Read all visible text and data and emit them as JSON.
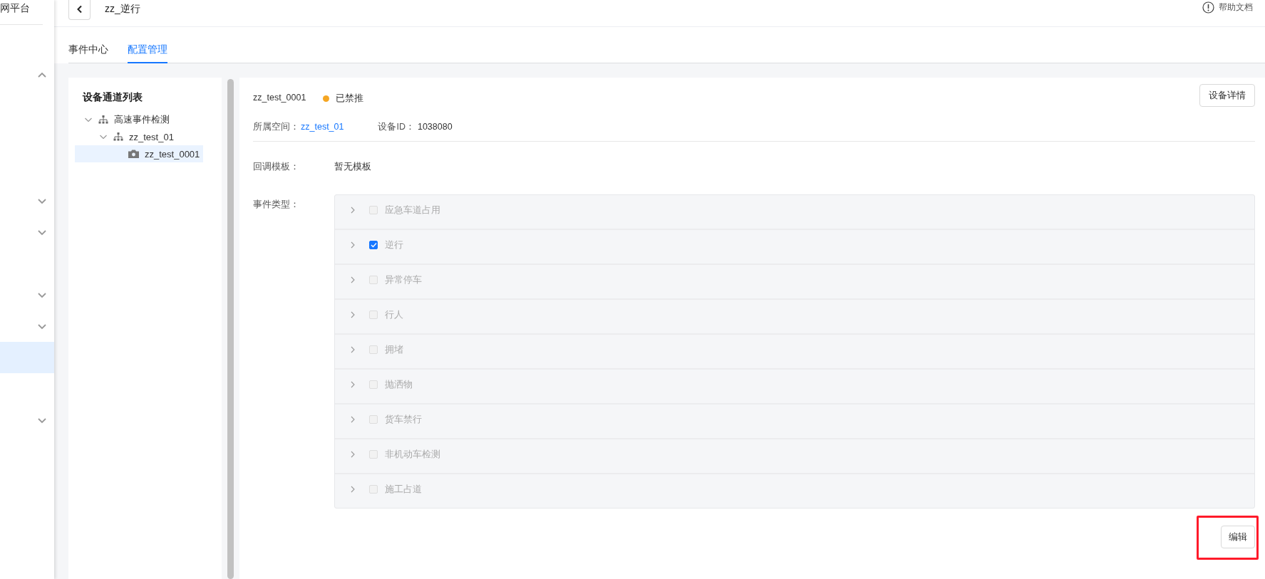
{
  "sidebar": {
    "title": "网平台",
    "items": [
      {
        "kind": "group",
        "expanded": true,
        "selected": false
      },
      {
        "kind": "entry",
        "selected": false
      },
      {
        "kind": "entry",
        "selected": false
      },
      {
        "kind": "entry",
        "selected": false
      },
      {
        "kind": "group",
        "expanded": false,
        "selected": false
      },
      {
        "kind": "group",
        "expanded": false,
        "selected": false
      },
      {
        "kind": "entry",
        "selected": false
      },
      {
        "kind": "group",
        "expanded": false,
        "selected": false
      },
      {
        "kind": "group",
        "expanded": false,
        "selected": false
      },
      {
        "kind": "entry",
        "selected": true
      },
      {
        "kind": "entry",
        "selected": false
      },
      {
        "kind": "group",
        "expanded": false,
        "selected": false
      }
    ]
  },
  "header": {
    "title": "zz_逆行",
    "help": "帮助文档"
  },
  "tabs": [
    {
      "label": "事件中心",
      "selected": false
    },
    {
      "label": "配置管理",
      "selected": true
    }
  ],
  "tree": {
    "title": "设备通道列表",
    "nodes": [
      {
        "label": "高速事件检测",
        "kind": "group",
        "expanded": true,
        "selected": false,
        "children": [
          {
            "label": "zz_test_01",
            "kind": "group",
            "expanded": true,
            "selected": false,
            "children": [
              {
                "label": "zz_test_0001",
                "kind": "camera",
                "selected": true
              }
            ]
          }
        ]
      }
    ]
  },
  "device": {
    "name": "zz_test_0001",
    "status": {
      "label": "已禁推",
      "color": "#f5a623"
    },
    "details_button": "设备详情",
    "space_label": "所属空间：",
    "space_value": "zz_test_01",
    "id_label": "设备ID：",
    "id_value": "1038080",
    "template_label": "回调模板：",
    "template_value": "暂无模板",
    "event_types_label": "事件类型：",
    "event_types": [
      {
        "label": "应急车道占用",
        "checked": false,
        "disabled": true,
        "expanded": false
      },
      {
        "label": "逆行",
        "checked": true,
        "disabled": true,
        "expanded": false
      },
      {
        "label": "异常停车",
        "checked": false,
        "disabled": true,
        "expanded": false
      },
      {
        "label": "行人",
        "checked": false,
        "disabled": true,
        "expanded": false
      },
      {
        "label": "拥堵",
        "checked": false,
        "disabled": true,
        "expanded": false
      },
      {
        "label": "抛洒物",
        "checked": false,
        "disabled": true,
        "expanded": false
      },
      {
        "label": "货车禁行",
        "checked": false,
        "disabled": true,
        "expanded": false
      },
      {
        "label": "非机动车检测",
        "checked": false,
        "disabled": true,
        "expanded": false
      },
      {
        "label": "施工占道",
        "checked": false,
        "disabled": true,
        "expanded": false
      }
    ],
    "edit_button": "编辑"
  }
}
